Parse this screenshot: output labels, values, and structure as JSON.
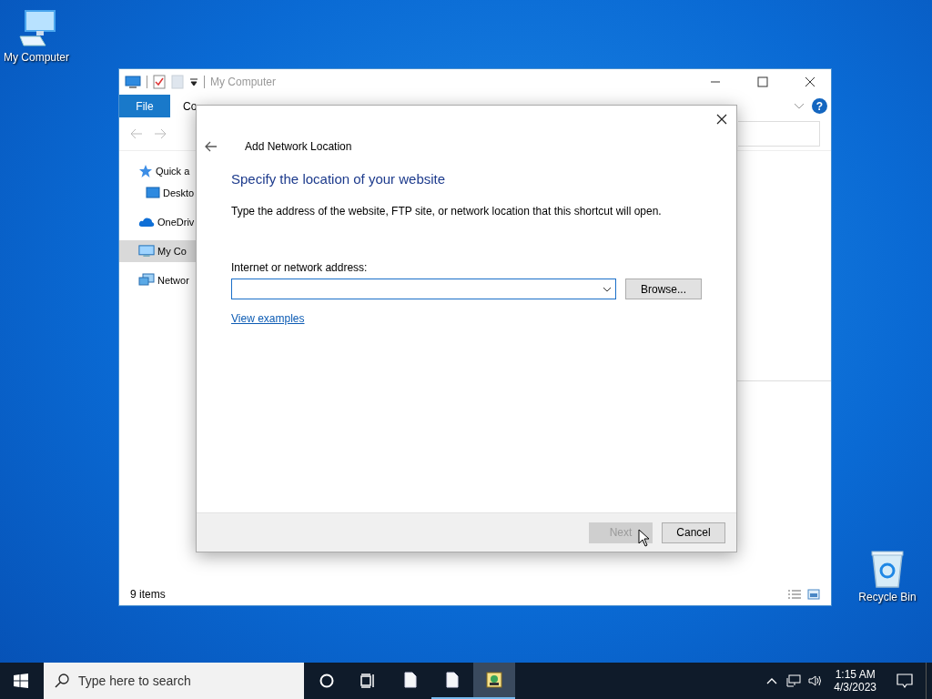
{
  "desktop_icons": [
    {
      "label": "My Computer",
      "kind": "computer"
    },
    {
      "label": "Recycle Bin",
      "kind": "recycle"
    }
  ],
  "explorer": {
    "title": "My Computer",
    "ribbon_tabs": [
      {
        "label": "File",
        "kind": "file-menu"
      },
      {
        "label": "Co",
        "kind": "tab"
      }
    ],
    "help": "?",
    "nav_items": [
      {
        "label": "Quick a",
        "kind": "star",
        "selected": false,
        "children": [
          {
            "label": "Deskto",
            "kind": "desktop",
            "selected": false
          }
        ]
      },
      {
        "label": "OneDriv",
        "kind": "cloud",
        "selected": false
      },
      {
        "label": "My Co",
        "kind": "computer",
        "selected": true
      },
      {
        "label": "Networ",
        "kind": "network",
        "selected": false
      }
    ],
    "status": "9 items"
  },
  "dialog": {
    "title": "Add Network Location",
    "heading": "Specify the location of your website",
    "description": "Type the address of the website, FTP site, or network location that this shortcut will open.",
    "address_label": "Internet or network address:",
    "browse": "Browse...",
    "link": "View examples",
    "buttons": [
      {
        "label": "Next",
        "disabled": true
      },
      {
        "label": "Cancel",
        "disabled": false
      }
    ]
  },
  "taskbar": {
    "search_placeholder": "Type here to search",
    "apps": [
      {
        "kind": "file",
        "running": false,
        "selected": false
      },
      {
        "kind": "file",
        "running": true,
        "selected": false
      },
      {
        "kind": "app",
        "running": true,
        "selected": true
      }
    ],
    "time": "1:15 AM",
    "date": "4/3/2023"
  }
}
